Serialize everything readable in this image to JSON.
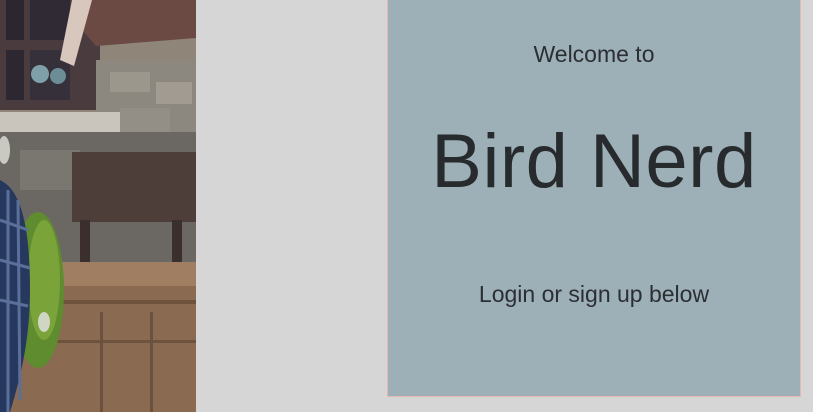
{
  "card": {
    "welcome": "Welcome to",
    "title": "Bird Nerd",
    "subtitle": "Login or sign up below"
  },
  "colors": {
    "background": "#d6d6d6",
    "card": "#9dafb7",
    "card_border": "#e6b8b4",
    "text": "#2b2f33"
  },
  "photo": {
    "icon": "bird-photo"
  }
}
